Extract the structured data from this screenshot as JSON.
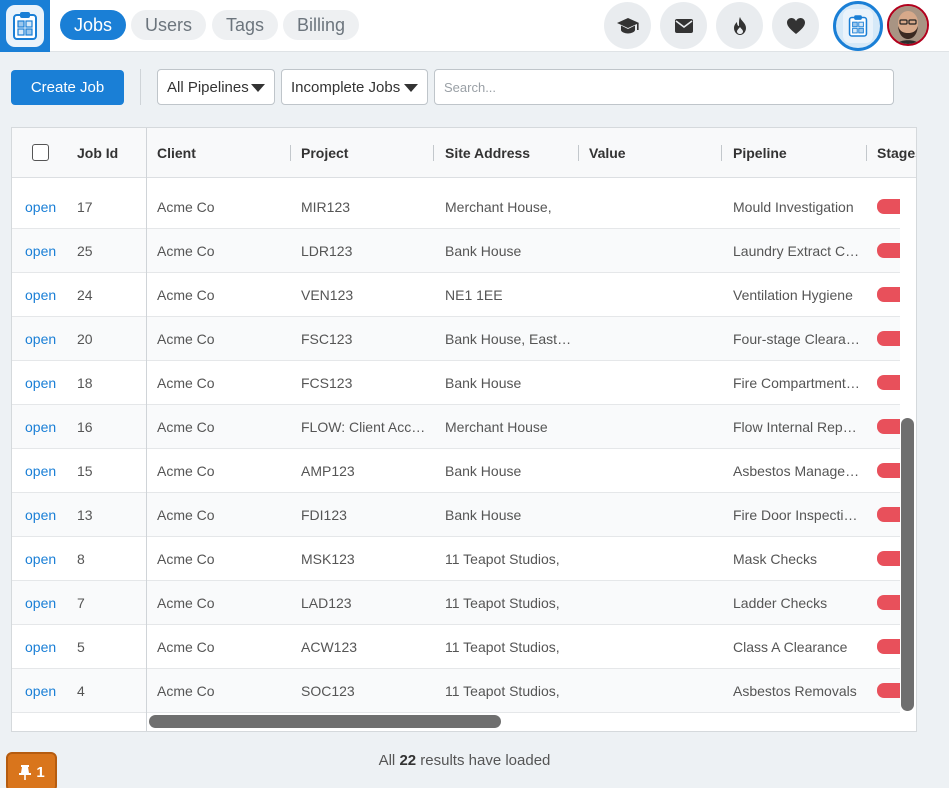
{
  "nav": {
    "tabs": [
      {
        "label": "Jobs",
        "active": true
      },
      {
        "label": "Users",
        "active": false
      },
      {
        "label": "Tags",
        "active": false
      },
      {
        "label": "Billing",
        "active": false
      }
    ],
    "icons": [
      "graduation-cap-icon",
      "envelope-icon",
      "fire-icon",
      "heart-icon"
    ]
  },
  "toolbar": {
    "create_label": "Create Job",
    "pipeline_select": "All Pipelines",
    "status_select": "Incomplete Jobs",
    "search_placeholder": "Search..."
  },
  "table": {
    "columns": [
      "Job Id",
      "Client",
      "Project",
      "Site Address",
      "Value",
      "Pipeline",
      "Stages"
    ],
    "rows": [
      {
        "action": "open",
        "id": "17",
        "client": "Acme Co",
        "project": "MIR123",
        "address": "Merchant House,",
        "value": "",
        "pipeline": "Mould Investigation"
      },
      {
        "action": "open",
        "id": "25",
        "client": "Acme Co",
        "project": "LDR123",
        "address": "Bank House",
        "value": "",
        "pipeline": "Laundry Extract Cle…"
      },
      {
        "action": "open",
        "id": "24",
        "client": "Acme Co",
        "project": "VEN123",
        "address": "NE1 1EE",
        "value": "",
        "pipeline": "Ventilation Hygiene"
      },
      {
        "action": "open",
        "id": "20",
        "client": "Acme Co",
        "project": "FSC123",
        "address": "Bank House, East, P…",
        "value": "",
        "pipeline": "Four-stage Clearan…"
      },
      {
        "action": "open",
        "id": "18",
        "client": "Acme Co",
        "project": "FCS123",
        "address": "Bank House",
        "value": "",
        "pipeline": "Fire Compartmenta…"
      },
      {
        "action": "open",
        "id": "16",
        "client": "Acme Co",
        "project": "FLOW: Client Acco…",
        "address": "Merchant House",
        "value": "",
        "pipeline": "Flow Internal Reports"
      },
      {
        "action": "open",
        "id": "15",
        "client": "Acme Co",
        "project": "AMP123",
        "address": "Bank House",
        "value": "",
        "pipeline": "Asbestos Manage…"
      },
      {
        "action": "open",
        "id": "13",
        "client": "Acme Co",
        "project": "FDI123",
        "address": "Bank House",
        "value": "",
        "pipeline": "Fire Door Inspections"
      },
      {
        "action": "open",
        "id": "8",
        "client": "Acme Co",
        "project": "MSK123",
        "address": "11 Teapot Studios,",
        "value": "",
        "pipeline": "Mask Checks"
      },
      {
        "action": "open",
        "id": "7",
        "client": "Acme Co",
        "project": "LAD123",
        "address": "11 Teapot Studios,",
        "value": "",
        "pipeline": "Ladder Checks"
      },
      {
        "action": "open",
        "id": "5",
        "client": "Acme Co",
        "project": "ACW123",
        "address": "11 Teapot Studios,",
        "value": "",
        "pipeline": "Class A Clearance"
      },
      {
        "action": "open",
        "id": "4",
        "client": "Acme Co",
        "project": "SOC123",
        "address": "11 Teapot Studios,",
        "value": "",
        "pipeline": "Asbestos Removals"
      }
    ],
    "stage_color": "#e8505b"
  },
  "footer": {
    "results_prefix": "All",
    "results_count": "22",
    "results_suffix": "results have loaded",
    "pin_count": "1"
  },
  "colors": {
    "accent": "#1a7fd6",
    "pin_badge": "#d9751c"
  }
}
